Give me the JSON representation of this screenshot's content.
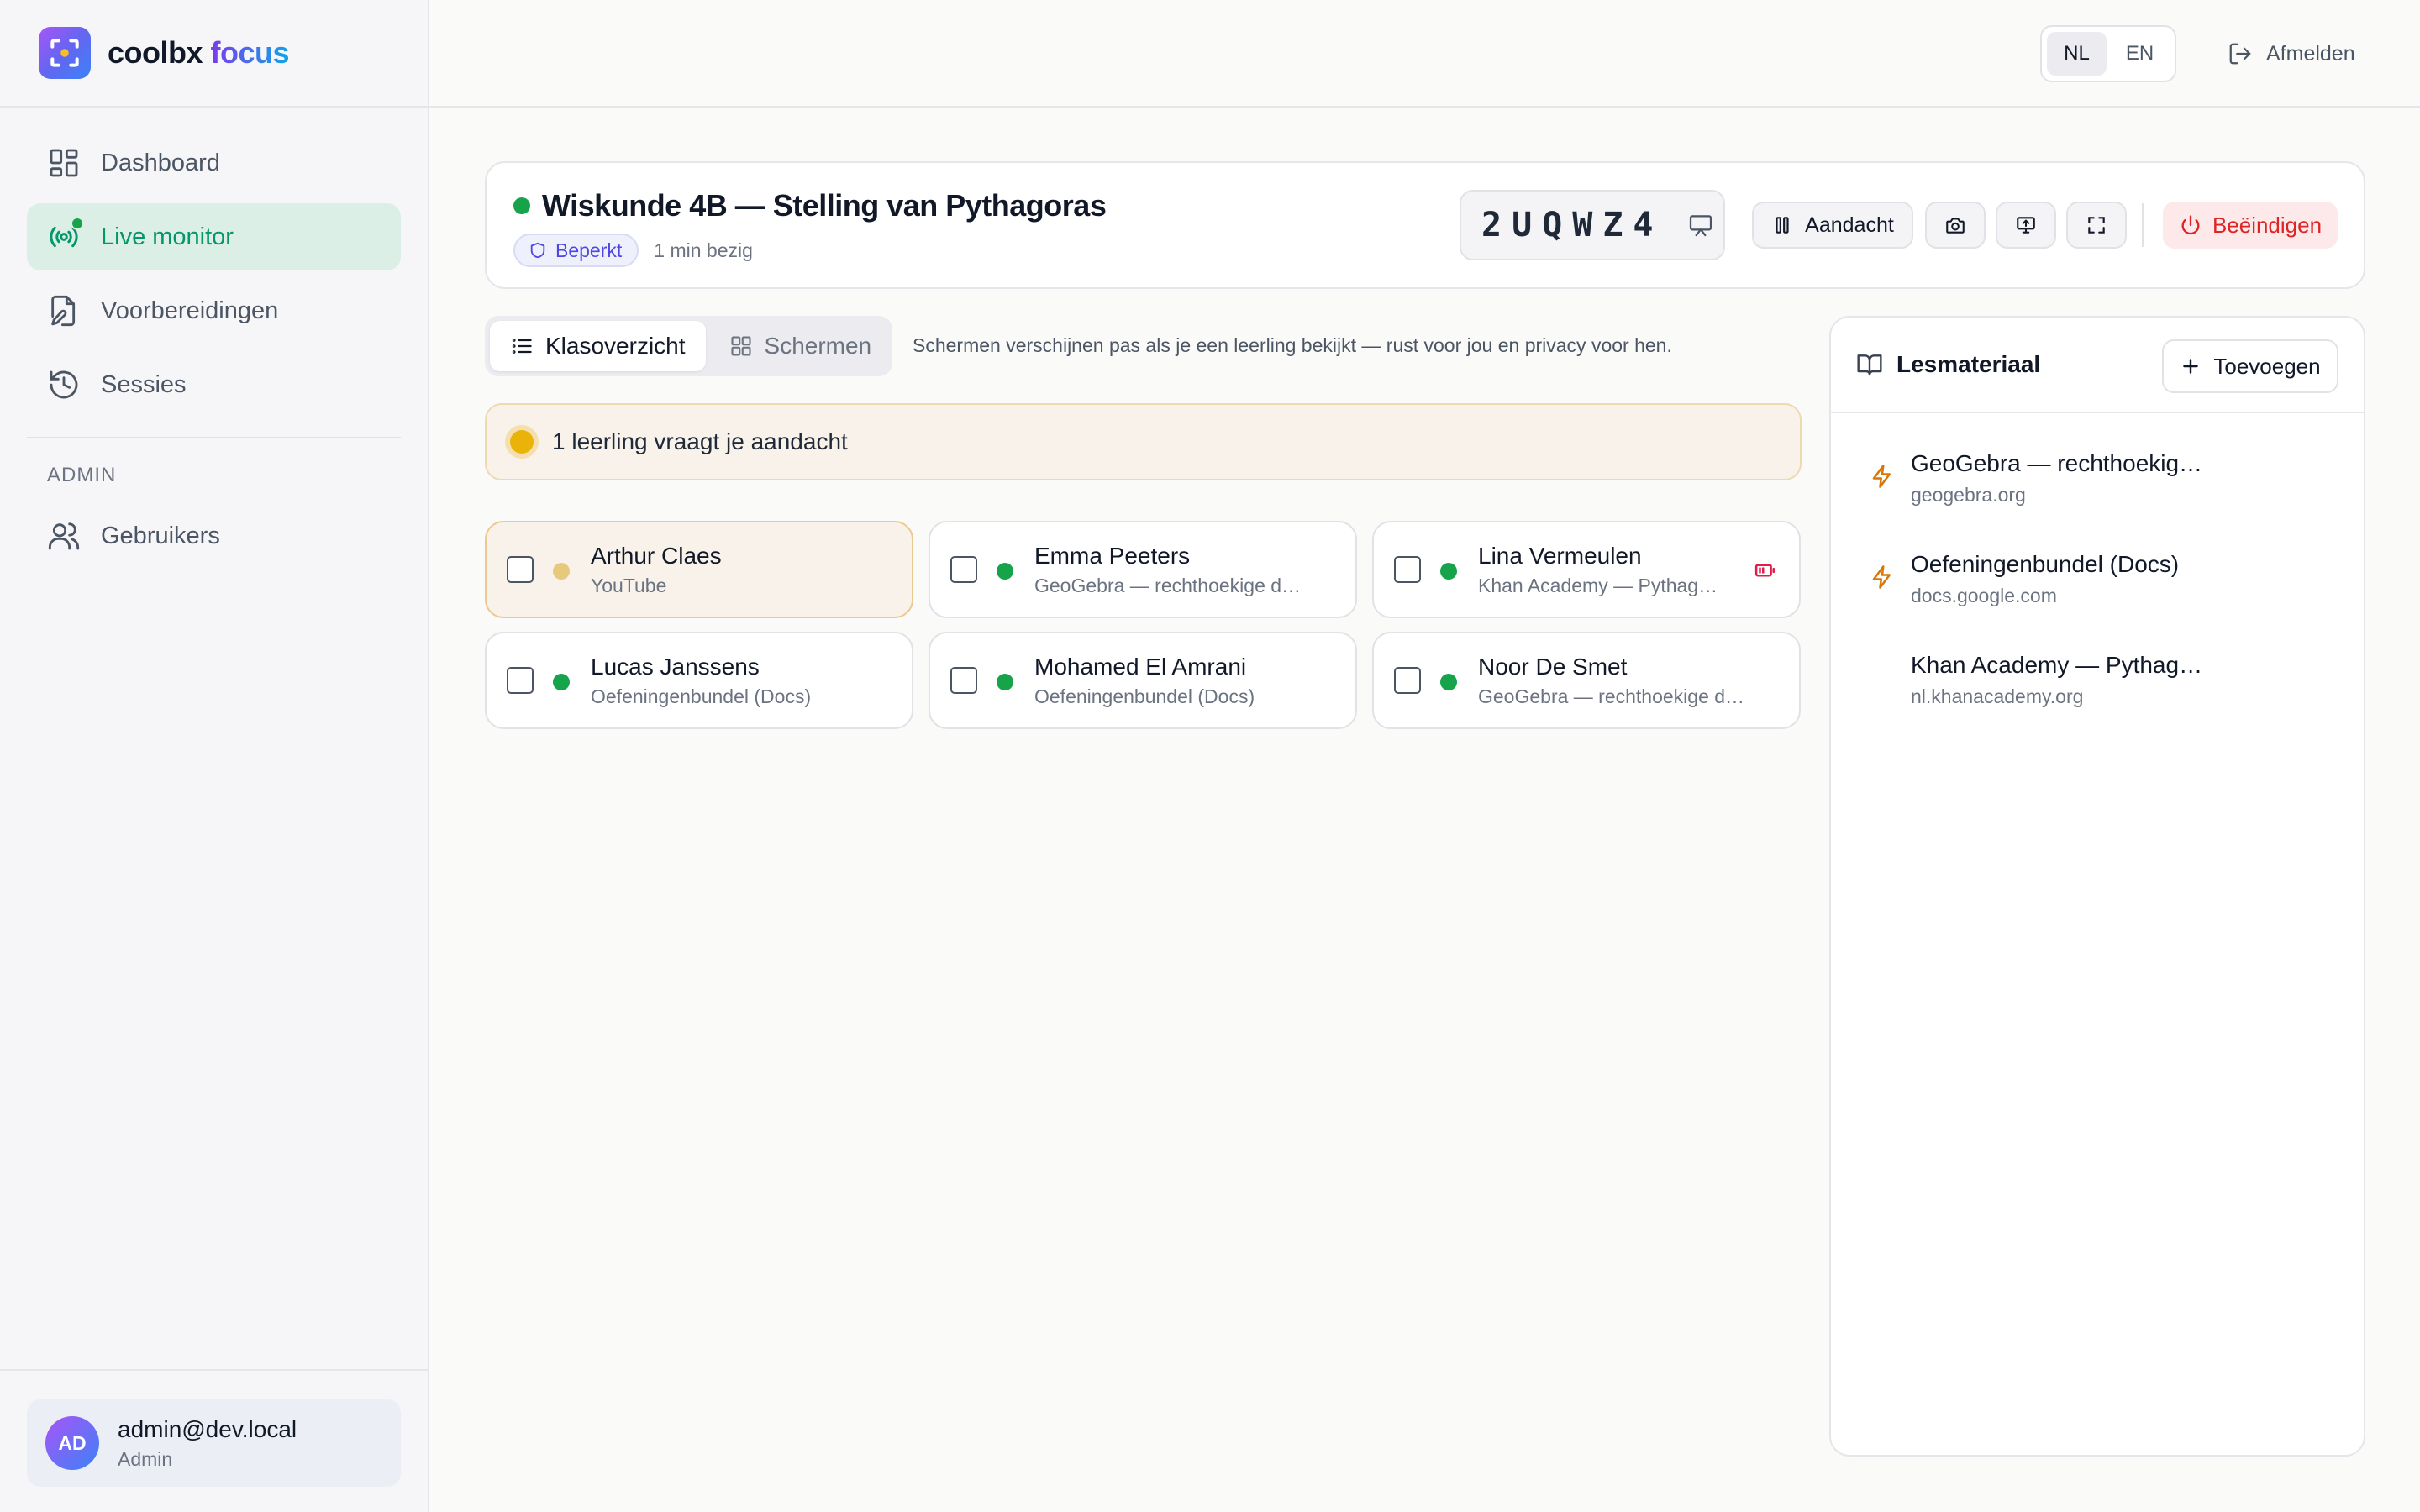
{
  "brand": {
    "name": "coolbx",
    "accent": "focus"
  },
  "nav": {
    "items": [
      {
        "label": "Dashboard",
        "icon": "dashboard-icon"
      },
      {
        "label": "Live monitor",
        "icon": "broadcast-icon",
        "active": true
      },
      {
        "label": "Voorbereidingen",
        "icon": "file-edit-icon"
      },
      {
        "label": "Sessies",
        "icon": "history-icon"
      }
    ],
    "admin_section": "ADMIN",
    "admin_items": [
      {
        "label": "Gebruikers",
        "icon": "users-icon"
      }
    ]
  },
  "user": {
    "initials": "AD",
    "email": "admin@dev.local",
    "role": "Admin"
  },
  "topbar": {
    "languages": [
      "NL",
      "EN"
    ],
    "selected_language": "NL",
    "logout_label": "Afmelden"
  },
  "session": {
    "title": "Wiskunde 4B — Stelling van Pythagoras",
    "mode_badge": "Beperkt",
    "elapsed": "1 min bezig",
    "join_code": "2UQWZ4",
    "attention_button": "Aandacht",
    "end_button": "Beëindigen"
  },
  "view": {
    "tabs": [
      {
        "label": "Klasoverzicht",
        "active": true
      },
      {
        "label": "Schermen"
      }
    ],
    "hint": "Schermen verschijnen pas als je een leerling bekijkt — rust voor jou en privacy voor hen."
  },
  "attention_banner": "1 leerling vraagt je aandacht",
  "students": [
    {
      "name": "Arthur Claes",
      "app": "YouTube",
      "status": "attention"
    },
    {
      "name": "Emma Peeters",
      "app": "GeoGebra — rechthoekige d…",
      "status": "ok"
    },
    {
      "name": "Lina Vermeulen",
      "app": "Khan Academy — Pythag…",
      "status": "ok",
      "recording": true
    },
    {
      "name": "Lucas Janssens",
      "app": "Oefeningenbundel (Docs)",
      "status": "ok"
    },
    {
      "name": "Mohamed El Amrani",
      "app": "Oefeningenbundel (Docs)",
      "status": "ok"
    },
    {
      "name": "Noor De Smet",
      "app": "GeoGebra — rechthoekige d…",
      "status": "ok"
    }
  ],
  "materials_panel": {
    "title": "Lesmateriaal",
    "add_label": "Toevoegen",
    "items": [
      {
        "title": "GeoGebra — rechthoekig…",
        "url": "geogebra.org",
        "pinned": true
      },
      {
        "title": "Oefeningenbundel (Docs)",
        "url": "docs.google.com",
        "pinned": true
      },
      {
        "title": "Khan Academy — Pythag…",
        "url": "nl.khanacademy.org",
        "pinned": false
      }
    ]
  },
  "colors": {
    "accent_green": "#059669",
    "status_ok": "#16a34a",
    "status_attention": "#eab308",
    "danger": "#dc2626",
    "badge_indigo": "#4f46e5"
  }
}
